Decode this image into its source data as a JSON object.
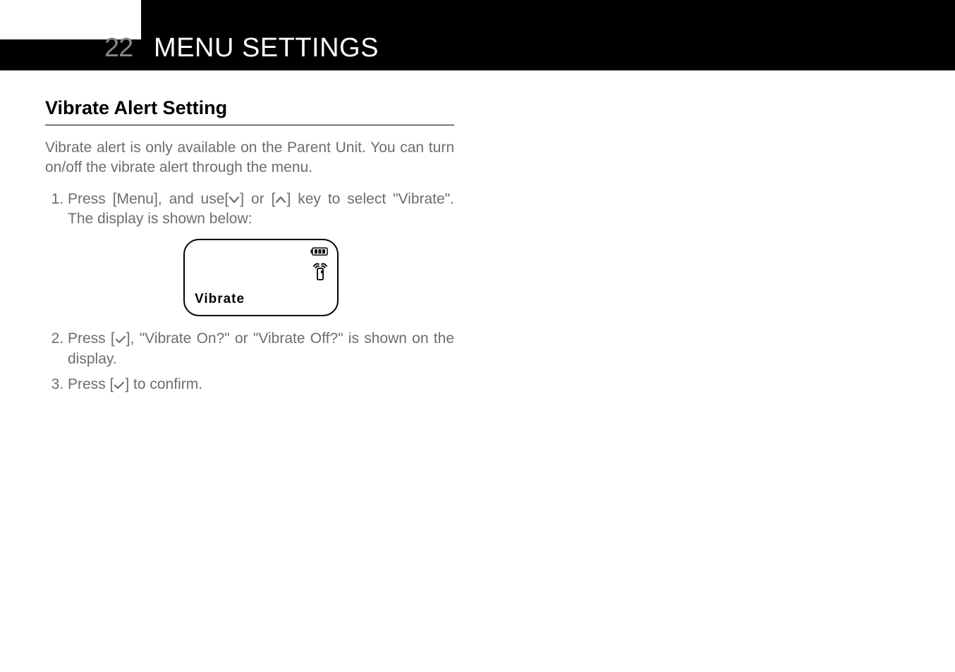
{
  "header": {
    "page_number": "22",
    "title": "MENU SETTINGS"
  },
  "section": {
    "title": "Vibrate Alert Setting",
    "intro": "Vibrate alert is only available on the Parent Unit. You can turn on/off the vibrate alert through the menu.",
    "steps": {
      "step1a": "Press [Menu], and use[",
      "step1b": "] or [",
      "step1c": "] key to select \"Vibrate\". The display is shown below:",
      "step2a": "Press [",
      "step2b": "], \"Vibrate On?\" or \"Vibrate Off?\" is shown on the display.",
      "step3a": "Press [",
      "step3b": "] to confirm."
    },
    "screen_label": "Vibrate"
  }
}
